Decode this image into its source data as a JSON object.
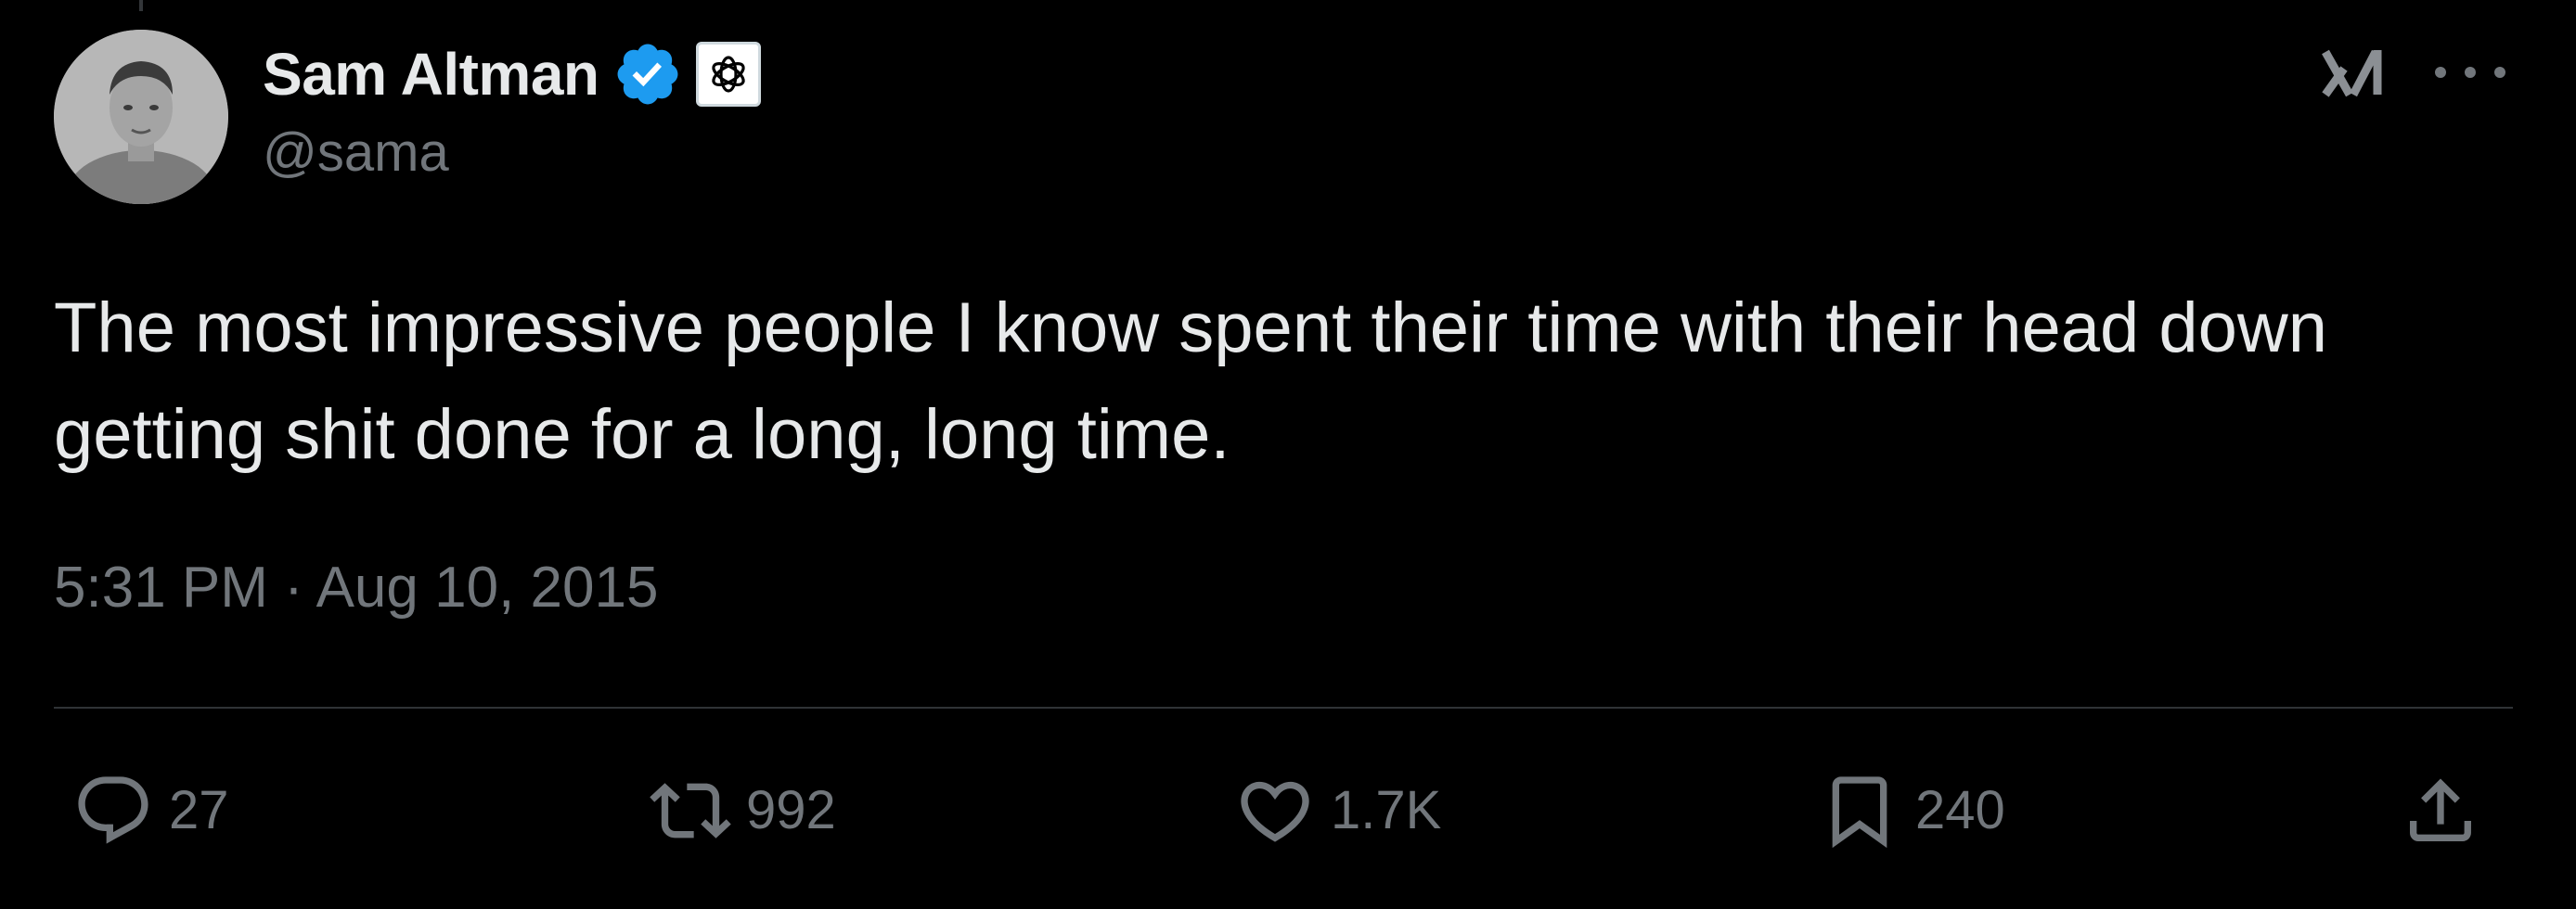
{
  "author": {
    "display_name": "Sam Altman",
    "handle": "@sama",
    "verified_icon": "verified-badge-icon",
    "affiliate_icon": "openai-logo-icon",
    "verified_color": "#1d9bf0"
  },
  "tweet": {
    "text": "The most impressive people I know spent their time with their head down getting shit done for a long, long time.",
    "timestamp": "5:31 PM · Aug 10, 2015"
  },
  "header_actions": {
    "grok_icon": "grok-icon",
    "more_icon": "more-options-icon"
  },
  "actions": {
    "reply": {
      "icon": "reply-icon",
      "count": "27"
    },
    "retweet": {
      "icon": "retweet-icon",
      "count": "992"
    },
    "like": {
      "icon": "heart-icon",
      "count": "1.7K"
    },
    "bookmark": {
      "icon": "bookmark-icon",
      "count": "240"
    },
    "share": {
      "icon": "share-icon"
    }
  },
  "colors": {
    "background": "#000000",
    "primary_text": "#e7e9ea",
    "secondary_text": "#71767b",
    "divider": "#2f3336"
  }
}
